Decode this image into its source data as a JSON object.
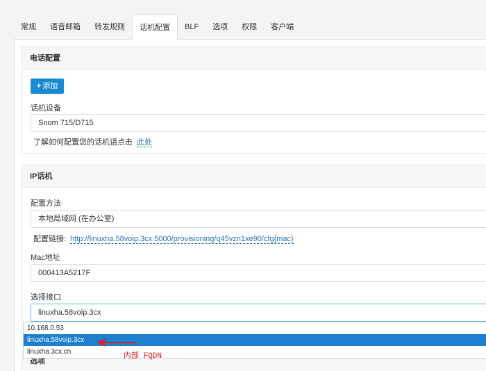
{
  "tabs": [
    "常规",
    "语音邮箱",
    "转发规则",
    "话机配置",
    "BLF",
    "选项",
    "权限",
    "客户端"
  ],
  "phone_config": {
    "title": "电话配置",
    "add_label": "添加",
    "device_label": "话机设备",
    "device_value": "Snom 715/D715",
    "help_text": "了解如何配置您的话机请点击",
    "help_link": "此处"
  },
  "ip_phone": {
    "title": "IP话机",
    "method_label": "配置方法",
    "method_value": "本地局域网 (在办公室)",
    "provision_label": "配置链接:",
    "provision_url": "http://linuxha.58voip.3cx:5000/provisioning/q45vzn1xe90/cfg{mac}",
    "mac_label": "Mac地址",
    "mac_value": "000413A5217F",
    "interface_label": "选择接口",
    "interface_value": "linuxha.58voip.3cx",
    "interface_options": [
      "10.168.0.53",
      "linuxha.58voip.3cx",
      "linuxha.3cx.cn"
    ],
    "selected_index": 1
  },
  "options_panel": {
    "title": "选项"
  },
  "annotation": {
    "text": "内部 FQDN",
    "color": "#e02020"
  }
}
